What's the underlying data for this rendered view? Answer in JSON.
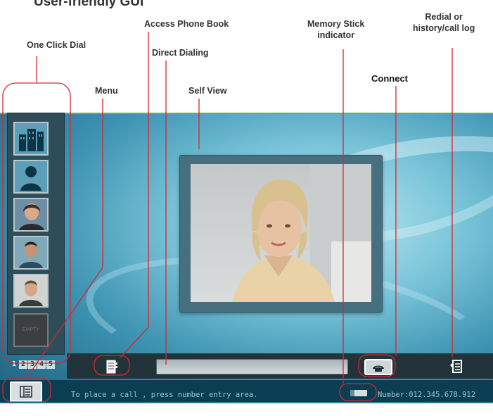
{
  "title": "User-friendly GUI",
  "labels": {
    "one_click_dial": "One Click Dial",
    "access_phone_book": "Access Phone Book",
    "direct_dialing": "Direct Dialing",
    "memory_stick_line1": "Memory Stick",
    "memory_stick_line2": "indicator",
    "redial_line1": "Redial or",
    "redial_line2": "history/call log",
    "menu": "Menu",
    "self_view": "Self View",
    "connect": "Connect"
  },
  "sidebar": {
    "items": [
      {
        "icon": "building-icon"
      },
      {
        "icon": "person-icon"
      },
      {
        "icon": "contact-photo-woman-icon"
      },
      {
        "icon": "contact-photo-man-icon"
      },
      {
        "icon": "contact-photo-man2-icon"
      },
      {
        "label": "EMPTY"
      }
    ],
    "pages": [
      "1",
      "2",
      "3",
      "4",
      "5"
    ]
  },
  "status": {
    "message": "To place a call , press number entry area.",
    "number": "Number:012.345.678.912"
  },
  "colors": {
    "callout": "#d7262e",
    "screen_bg": "#3d93b2",
    "sidebar_bg": "#2f4c59"
  }
}
